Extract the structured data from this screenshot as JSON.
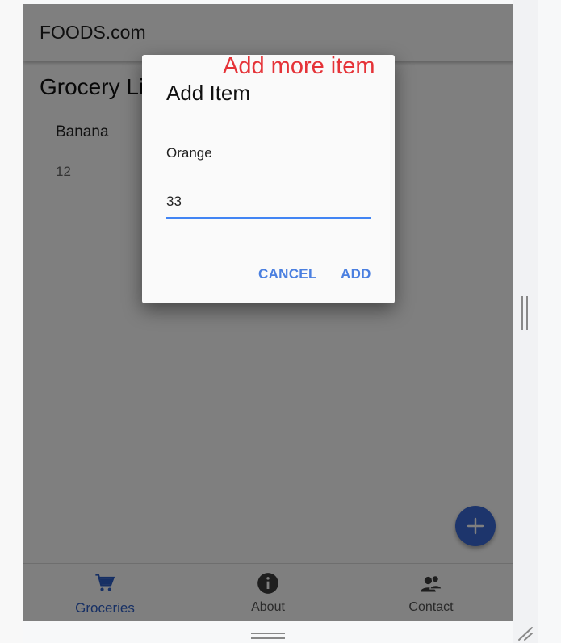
{
  "app": {
    "title": "FOODS.com",
    "list_title": "Grocery List",
    "items": [
      {
        "name": "Banana",
        "quantity": "12"
      }
    ]
  },
  "dialog": {
    "title": "Add Item",
    "name_value": "Orange",
    "quantity_value": "33",
    "cancel_label": "CANCEL",
    "add_label": "ADD"
  },
  "annotation": {
    "text": "Add more item"
  },
  "bottom_nav": {
    "items": [
      {
        "label": "Groceries",
        "icon": "cart-icon",
        "active": true
      },
      {
        "label": "About",
        "icon": "info-icon",
        "active": false
      },
      {
        "label": "Contact",
        "icon": "contact-icon",
        "active": false
      }
    ]
  },
  "fab": {
    "icon": "plus-icon"
  },
  "colors": {
    "primary": "#3a6ad8",
    "accent_button": "#4a7fe0",
    "annotation": "#e53338",
    "active_nav": "#2d5fc9"
  }
}
